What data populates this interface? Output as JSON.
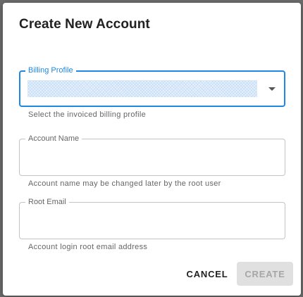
{
  "dialog": {
    "title": "Create New Account"
  },
  "fields": {
    "billing_profile": {
      "label": "Billing Profile",
      "helper": "Select the invoiced billing profile"
    },
    "account_name": {
      "label": "Account Name",
      "value": "",
      "helper": "Account name may be changed later by the root user"
    },
    "root_email": {
      "label": "Root Email",
      "value": "",
      "helper": "Account login root email address"
    }
  },
  "actions": {
    "cancel_label": "CANCEL",
    "create_label": "CREATE"
  },
  "colors": {
    "accent": "#1e88e5",
    "disabled_bg": "#e0e0e0",
    "disabled_text": "#a6a6a6"
  },
  "icons": {
    "dropdown": "caret-down-icon"
  }
}
